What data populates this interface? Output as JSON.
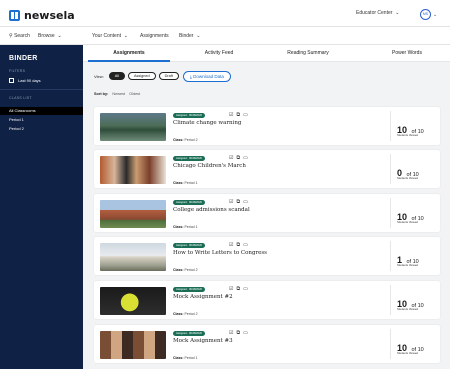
{
  "header": {
    "logo_text": "newsela",
    "role_select": "Educator Center",
    "avatar_initials": "MS"
  },
  "nav": {
    "search": "Search",
    "browse": "Browse",
    "your_content": "Your Content",
    "assignments": "Assignments",
    "binder": "Binder"
  },
  "sidebar": {
    "title": "BINDER",
    "filters_label": "FILTERS",
    "date_filter": "Last 90 days",
    "class_list_label": "CLASS LIST",
    "classes": [
      "All Classrooms",
      "Period 1",
      "Period 2"
    ]
  },
  "tabs": [
    "Assignments",
    "Activity Feed",
    "Reading Summary",
    "Power Words"
  ],
  "controls": {
    "view_label": "View:",
    "view_options": [
      "All",
      "Assigned",
      "Draft"
    ],
    "download_label": "Download Data",
    "sort_label": "Sort by:",
    "sort_options": [
      "Newest",
      "Oldest"
    ]
  },
  "assignments": [
    {
      "badge": "Assigned · 06/18/2020",
      "title": "Climate change warning",
      "class_label": "Class:",
      "class_name": "Period 2",
      "viewed": "10",
      "total": "of 10",
      "viewed_caption": "Students Viewed"
    },
    {
      "badge": "Assigned · 06/18/2020",
      "title": "Chicago Children's March",
      "class_label": "Class:",
      "class_name": "Period 1",
      "viewed": "0",
      "total": "of 10",
      "viewed_caption": "Students Viewed"
    },
    {
      "badge": "Assigned · 06/18/2020",
      "title": "College admissions scandal",
      "class_label": "Class:",
      "class_name": "Period 1",
      "viewed": "10",
      "total": "of 10",
      "viewed_caption": "Students Viewed"
    },
    {
      "badge": "Assigned · 06/18/2020",
      "title": "How to Write Letters to Congress",
      "class_label": "Class:",
      "class_name": "Period 2",
      "viewed": "1",
      "total": "of 10",
      "viewed_caption": "Students Viewed"
    },
    {
      "badge": "Assigned · 06/18/2020",
      "title": "Mock Assignment #2",
      "class_label": "Class:",
      "class_name": "Period 2",
      "viewed": "10",
      "total": "of 10",
      "viewed_caption": "Students Viewed"
    },
    {
      "badge": "Assigned · 06/18/2020",
      "title": "Mock Assignment #3",
      "class_label": "Class:",
      "class_name": "Period 1",
      "viewed": "10",
      "total": "of 10",
      "viewed_caption": "Students Viewed"
    }
  ],
  "colors": {
    "sidebar_bg": "#0f2245",
    "accent": "#1c6fd1",
    "badge_green": "#1b6e55"
  }
}
